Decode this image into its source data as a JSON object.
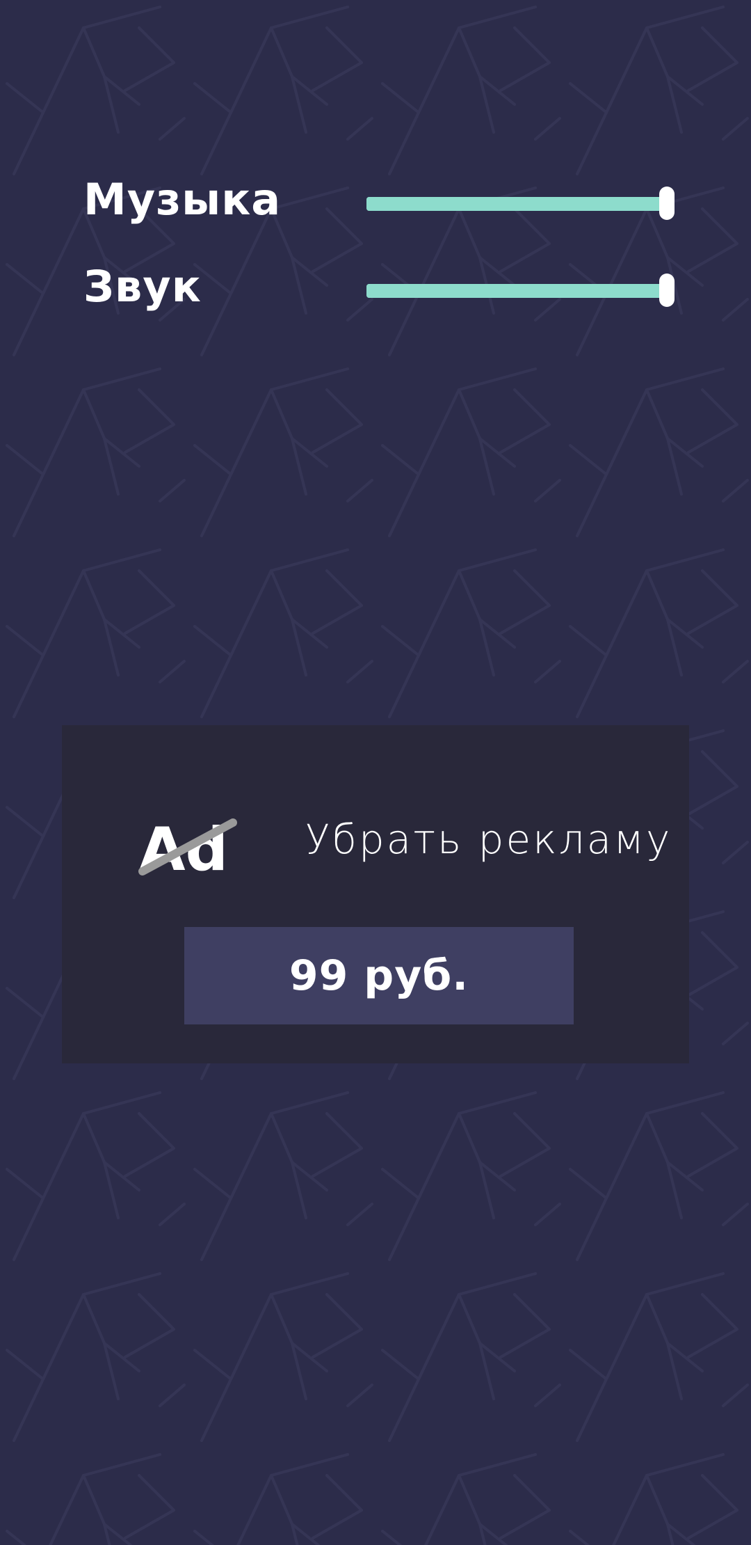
{
  "colors": {
    "background": "#2c2c4a",
    "pattern_stroke": "#353555",
    "accent": "#8ddccc",
    "panel": "#29283a",
    "button": "#3f3f62",
    "text": "#ffffff",
    "strike": "#9a9a9a"
  },
  "settings": {
    "music": {
      "label": "Музыка",
      "level": 1.0
    },
    "sound": {
      "label": "Звук",
      "level": 1.0
    }
  },
  "remove_ads": {
    "icon_text": "Ad",
    "title": "Убрать рекламу",
    "price_label": "99 руб."
  }
}
